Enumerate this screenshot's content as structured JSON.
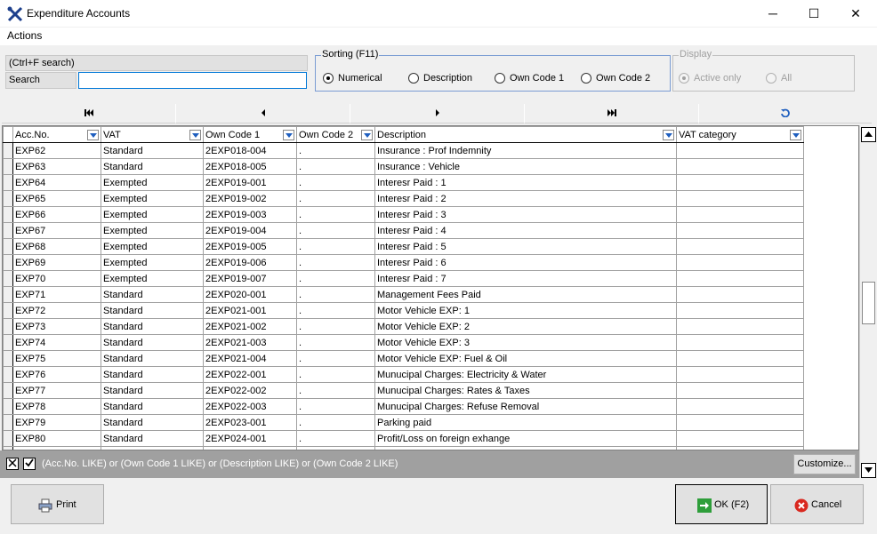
{
  "window": {
    "title": "Expenditure Accounts",
    "minimize": "─",
    "maximize": "☐",
    "close": "✕"
  },
  "menu": {
    "actions": "Actions"
  },
  "search": {
    "hint": "(Ctrl+F search)",
    "label": "Search",
    "value": ""
  },
  "sorting": {
    "title": "Sorting (F11)",
    "options": [
      "Numerical",
      "Description",
      "Own Code 1",
      "Own Code 2"
    ],
    "selected": "Numerical"
  },
  "display": {
    "title": "Display",
    "options": [
      "Active only",
      "All"
    ],
    "selected": "Active only"
  },
  "navigator": {
    "icons": [
      "first-record-icon",
      "prior-record-icon",
      "next-record-icon",
      "last-record-icon",
      "refresh-icon"
    ]
  },
  "grid": {
    "columns": [
      "Acc.No.",
      "VAT",
      "Own Code 1",
      "Own Code 2",
      "Description",
      "VAT category"
    ],
    "rows": [
      [
        "EXP62",
        "Standard",
        "2EXP018-004",
        ".",
        "Insurance : Prof Indemnity",
        ""
      ],
      [
        "EXP63",
        "Standard",
        "2EXP018-005",
        ".",
        "Insurance : Vehicle",
        ""
      ],
      [
        "EXP64",
        "Exempted",
        "2EXP019-001",
        ".",
        "Interesr Paid : 1",
        ""
      ],
      [
        "EXP65",
        "Exempted",
        "2EXP019-002",
        ".",
        "Interesr Paid : 2",
        ""
      ],
      [
        "EXP66",
        "Exempted",
        "2EXP019-003",
        ".",
        "Interesr Paid : 3",
        ""
      ],
      [
        "EXP67",
        "Exempted",
        "2EXP019-004",
        ".",
        "Interesr Paid : 4",
        ""
      ],
      [
        "EXP68",
        "Exempted",
        "2EXP019-005",
        ".",
        "Interesr Paid : 5",
        ""
      ],
      [
        "EXP69",
        "Exempted",
        "2EXP019-006",
        ".",
        "Interesr Paid : 6",
        ""
      ],
      [
        "EXP70",
        "Exempted",
        "2EXP019-007",
        ".",
        "Interesr Paid : 7",
        ""
      ],
      [
        "EXP71",
        "Standard",
        "2EXP020-001",
        ".",
        "Management Fees Paid",
        ""
      ],
      [
        "EXP72",
        "Standard",
        "2EXP021-001",
        ".",
        "Motor Vehicle EXP: 1",
        ""
      ],
      [
        "EXP73",
        "Standard",
        "2EXP021-002",
        ".",
        "Motor Vehicle EXP: 2",
        ""
      ],
      [
        "EXP74",
        "Standard",
        "2EXP021-003",
        ".",
        "Motor Vehicle EXP: 3",
        ""
      ],
      [
        "EXP75",
        "Standard",
        "2EXP021-004",
        ".",
        "Motor Vehicle EXP: Fuel & Oil",
        ""
      ],
      [
        "EXP76",
        "Standard",
        "2EXP022-001",
        ".",
        "Munucipal Charges: Electricity & Water",
        ""
      ],
      [
        "EXP77",
        "Standard",
        "2EXP022-002",
        ".",
        "Munucipal Charges: Rates & Taxes",
        ""
      ],
      [
        "EXP78",
        "Standard",
        "2EXP022-003",
        ".",
        "Munucipal Charges: Refuse Removal",
        ""
      ],
      [
        "EXP79",
        "Standard",
        "2EXP023-001",
        ".",
        "Parking paid",
        ""
      ],
      [
        "EXP80",
        "Standard",
        "2EXP024-001",
        ".",
        "Profit/Loss on foreign exhange",
        ""
      ],
      [
        "",
        "",
        "",
        "",
        "",
        ""
      ]
    ]
  },
  "filter": {
    "text": "(Acc.No. LIKE) or (Own Code 1 LIKE) or (Description LIKE) or (Own Code 2 LIKE)",
    "customize": "Customize..."
  },
  "buttons": {
    "print": "Print",
    "ok": "OK (F2)",
    "cancel": "Cancel"
  },
  "colors": {
    "ok_icon": "#2e9e3a",
    "cancel_icon": "#d9281f",
    "filter_bar": "#a0a0a0",
    "group_border": "#7a9cd3"
  }
}
